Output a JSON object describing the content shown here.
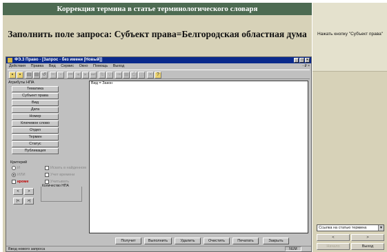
{
  "slide": {
    "title": "Коррекция термина в статье терминологического словаря",
    "task": "Заполнить поле запроса: Субъект права=Белгородская областная дума"
  },
  "side": {
    "instruction": "Нажать кнопку \"Субъект права\"",
    "select_value": "Ссылка на статью термина",
    "back_label": "<",
    "forward_label": ">",
    "close_label": "Выход",
    "dim_label": "Начало"
  },
  "app": {
    "title": "ФЭ.3 Право - [Запрос - без имени [Новый]]",
    "menu": [
      "Действия",
      "Правка",
      "Вид",
      "Сервис",
      "Окно",
      "Помощь",
      "Выход"
    ],
    "mdi_controls": "- ₽ ×",
    "attributes_title": "Атрибуты НПА",
    "attribute_buttons": [
      "Тематика",
      "Субъект права",
      "Вид",
      "Дата",
      "Номер",
      "Ключевое слово",
      "Отдел",
      "Термин",
      "Статус",
      "Публикация"
    ],
    "criteria_title": "Критерий",
    "radio1": "И",
    "radio2": "ИЛИ",
    "not_label": "кроме",
    "opt1": "Искать в найденном",
    "opt2": "Учет времени",
    "opt3": "Учитывать",
    "nav_prev": "<",
    "nav_next": ">",
    "nav_first": "|<",
    "nav_last": ">|",
    "count_label": "Количество НПА",
    "query_text": "Вид = Закон",
    "bottom_buttons": [
      "Получит",
      "Выполнить",
      "Удалить",
      "Очистить",
      "Печатать",
      "Закрыть"
    ],
    "status_text": "Ввод нового запроса",
    "status_num": "NUM"
  }
}
